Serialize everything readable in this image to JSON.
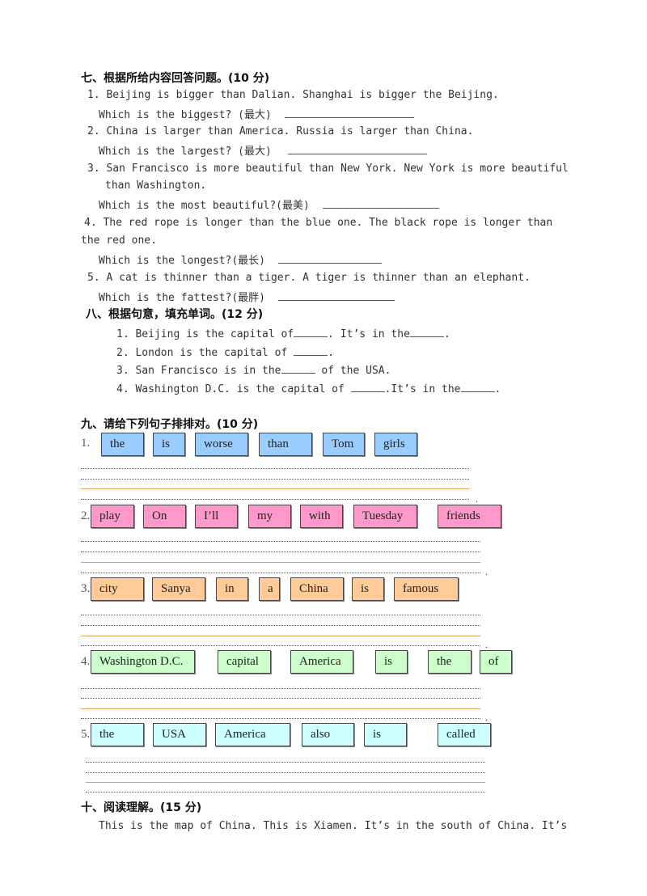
{
  "section7": {
    "title": "七、根据所给内容回答问题。(10 分)",
    "items": [
      {
        "statement": "1. Beijing is bigger than Dalian. Shanghai is bigger the Beijing.",
        "question": "Which is the biggest? (最大)"
      },
      {
        "statement": "2. China is larger than America. Russia is larger than China.",
        "question": "Which is the largest? (最大)"
      },
      {
        "statement": "3. San Francisco is more beautiful than New York.  New York is more beautiful",
        "statement_cont": "than Washington.",
        "question": "Which is the most beautiful?(最美)"
      },
      {
        "statement": "4. The red rope is longer than the blue one. The black rope is longer than",
        "statement_cont": "the red one.",
        "question": "Which is the longest?(最长)"
      },
      {
        "statement": "5. A cat is thinner than a tiger. A tiger is thinner than an elephant.",
        "question": "Which is the fattest?(最胖)"
      }
    ]
  },
  "section8": {
    "title": "八、根据句意，填充单词。(12 分)",
    "items": [
      {
        "num": "1.",
        "parts": [
          "Beijing is the capital of",
          ". It’s in the",
          "."
        ]
      },
      {
        "num": "2.",
        "parts": [
          "London is the capital of ",
          "."
        ]
      },
      {
        "num": "3.",
        "parts": [
          "San Francisco is in the",
          " of the USA."
        ]
      },
      {
        "num": "4.",
        "parts": [
          "Washington D.C. is the capital of ",
          ".It’s in the",
          "."
        ]
      }
    ]
  },
  "section9": {
    "title": "九、请给下列句子排排对。(10 分)",
    "groups": [
      {
        "num": "1.",
        "words": [
          "the",
          "is",
          "worse",
          "than",
          "Tom",
          "girls"
        ]
      },
      {
        "num": "2.",
        "words": [
          "play",
          "On",
          "I’ll",
          "my",
          "with",
          "Tuesday",
          "friends"
        ]
      },
      {
        "num": "3.",
        "words": [
          "city",
          "Sanya",
          "in",
          "a",
          "China",
          "is",
          "famous"
        ]
      },
      {
        "num": "4.",
        "words": [
          "Washington D.C.",
          "capital",
          "America",
          "is",
          "the",
          "of"
        ]
      },
      {
        "num": "5.",
        "words": [
          "the",
          "USA",
          "America",
          "also",
          "is",
          "called"
        ]
      }
    ],
    "period": "."
  },
  "section10": {
    "title": "十、阅读理解。(15 分)",
    "text": "This is the map of China. This is Xiamen. It’s in the south of China. It’s"
  }
}
